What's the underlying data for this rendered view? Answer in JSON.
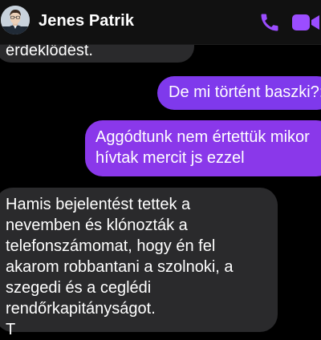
{
  "header": {
    "contact_name": "Jenes Patrik",
    "call_icon": "phone-icon",
    "video_icon": "video-camera-icon",
    "accent_color": "#9b4dff"
  },
  "messages": [
    {
      "direction": "incoming",
      "lines": [
        "érdeklődést."
      ]
    },
    {
      "direction": "outgoing",
      "lines": [
        "De mi történt baszki?:"
      ]
    },
    {
      "direction": "outgoing",
      "lines": [
        "Aggódtunk nem értettük mikor",
        "hívtak mercit js ezzel"
      ]
    },
    {
      "direction": "incoming",
      "lines": [
        "Hamis bejelentést tettek a",
        "nevemben és klónozták a",
        "telefonszámomat, hogy én fel",
        "akarom robbantani a szolnoki, a",
        "szegedi és a ceglédi",
        "rendőrkapitányságot.",
        "T"
      ]
    }
  ],
  "colors": {
    "background": "#000000",
    "incoming_bubble": "#2a2a2c",
    "outgoing_bubble": "#7f39ec"
  }
}
